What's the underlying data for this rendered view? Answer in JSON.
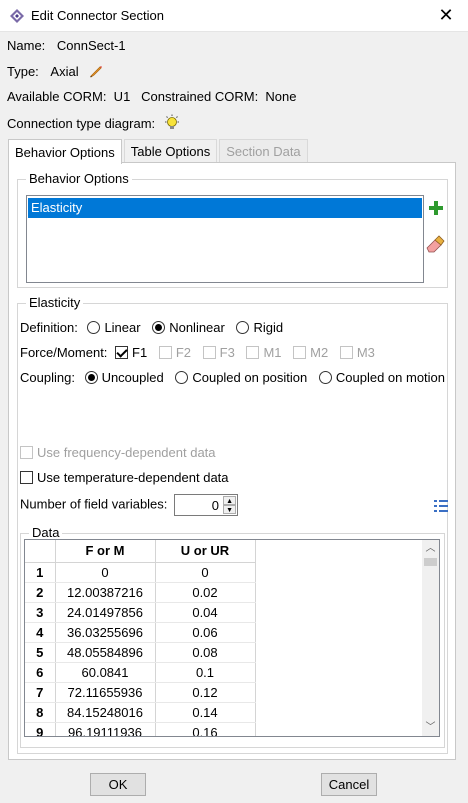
{
  "window": {
    "title": "Edit Connector Section",
    "close_glyph": "✕"
  },
  "info": {
    "name_label": "Name:",
    "name_value": "ConnSect-1",
    "type_label": "Type:",
    "type_value": "Axial",
    "corm_line": "Available CORM:  U1   Constrained CORM:  None",
    "diagram_label": "Connection type diagram:"
  },
  "tabs": [
    {
      "label": "Behavior Options"
    },
    {
      "label": "Table Options"
    },
    {
      "label": "Section Data"
    }
  ],
  "behavior": {
    "group_title": "Behavior Options",
    "items": [
      "Elasticity"
    ]
  },
  "elasticity": {
    "group_title": "Elasticity",
    "definition_label": "Definition:",
    "definition_options": [
      "Linear",
      "Nonlinear",
      "Rigid"
    ],
    "definition_selected": "Nonlinear",
    "force_label": "Force/Moment:",
    "force_options": [
      "F1",
      "F2",
      "F3",
      "M1",
      "M2",
      "M3"
    ],
    "force_checked": [
      "F1"
    ],
    "coupling_label": "Coupling:",
    "coupling_options": [
      "Uncoupled",
      "Coupled on position",
      "Coupled on motion"
    ],
    "coupling_selected": "Uncoupled",
    "freq_label": "Use frequency-dependent data",
    "temp_label": "Use temperature-dependent data",
    "field_vars_label": "Number of field variables:",
    "field_vars_value": "0",
    "data_title": "Data",
    "columns": [
      "F or M",
      "U or UR"
    ],
    "rows": [
      [
        "1",
        "0",
        "0"
      ],
      [
        "2",
        "12.00387216",
        "0.02"
      ],
      [
        "3",
        "24.01497856",
        "0.04"
      ],
      [
        "4",
        "36.03255696",
        "0.06"
      ],
      [
        "5",
        "48.05584896",
        "0.08"
      ],
      [
        "6",
        "60.0841",
        "0.1"
      ],
      [
        "7",
        "72.11655936",
        "0.12"
      ],
      [
        "8",
        "84.15248016",
        "0.14"
      ],
      [
        "9",
        "96.19111936",
        "0.16"
      ]
    ]
  },
  "buttons": {
    "ok": "OK",
    "cancel": "Cancel"
  }
}
